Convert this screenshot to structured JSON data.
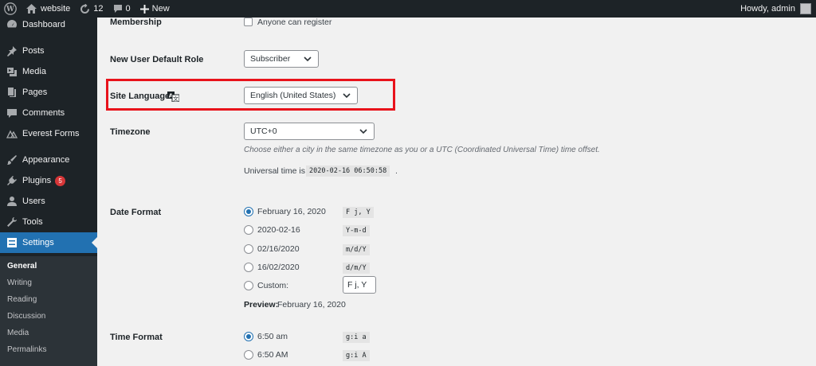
{
  "adminbar": {
    "site_name": "website",
    "updates_count": "12",
    "comments_count": "0",
    "new_label": "New",
    "greeting": "Howdy, admin"
  },
  "sidebar": {
    "items": [
      {
        "label": "Dashboard",
        "icon": "dashboard-icon"
      },
      {
        "label": "Posts",
        "icon": "pin-icon"
      },
      {
        "label": "Media",
        "icon": "media-icon"
      },
      {
        "label": "Pages",
        "icon": "pages-icon"
      },
      {
        "label": "Comments",
        "icon": "comment-icon"
      },
      {
        "label": "Everest Forms",
        "icon": "everest-forms-icon"
      },
      {
        "label": "Appearance",
        "icon": "paintbrush-icon"
      },
      {
        "label": "Plugins",
        "icon": "plugin-icon",
        "badge": "5"
      },
      {
        "label": "Users",
        "icon": "user-icon"
      },
      {
        "label": "Tools",
        "icon": "wrench-icon"
      },
      {
        "label": "Settings",
        "icon": "settings-icon"
      }
    ],
    "submenu": [
      "General",
      "Writing",
      "Reading",
      "Discussion",
      "Media",
      "Permalinks"
    ]
  },
  "form": {
    "membership": {
      "label": "Membership",
      "checkbox_label": "Anyone can register"
    },
    "default_role": {
      "label": "New User Default Role",
      "value": "Subscriber"
    },
    "site_language": {
      "label": "Site Language",
      "value": "English (United States)"
    },
    "timezone": {
      "label": "Timezone",
      "value": "UTC+0",
      "description": "Choose either a city in the same timezone as you or a UTC (Coordinated Universal Time) time offset.",
      "universal_prefix": "Universal time is",
      "universal_value": "2020-02-16 06:50:58",
      "universal_suffix": "."
    },
    "date_format": {
      "label": "Date Format",
      "options": [
        {
          "label": "February 16, 2020",
          "code": "F j, Y",
          "checked": true
        },
        {
          "label": "2020-02-16",
          "code": "Y-m-d",
          "checked": false
        },
        {
          "label": "02/16/2020",
          "code": "m/d/Y",
          "checked": false
        },
        {
          "label": "16/02/2020",
          "code": "d/m/Y",
          "checked": false
        }
      ],
      "custom_label": "Custom:",
      "custom_value": "F j, Y",
      "preview_label": "Preview:",
      "preview_value": "February 16, 2020"
    },
    "time_format": {
      "label": "Time Format",
      "options": [
        {
          "label": "6:50 am",
          "code": "g:i a",
          "checked": true
        },
        {
          "label": "6:50 AM",
          "code": "g:i A",
          "checked": false
        }
      ]
    }
  },
  "colors": {
    "adminbar_bg": "#1d2327",
    "active_blue": "#2271b1",
    "highlight_red": "#e8121b",
    "badge_red": "#d63638"
  }
}
